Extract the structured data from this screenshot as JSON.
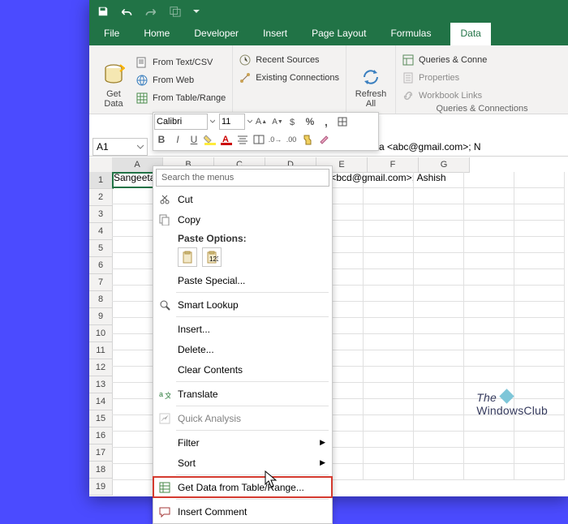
{
  "tabs": {
    "file": "File",
    "home": "Home",
    "developer": "Developer",
    "insert": "Insert",
    "pagelayout": "Page Layout",
    "formulas": "Formulas",
    "data": "Data"
  },
  "ribbon": {
    "getdata": "Get\nData",
    "fromtextcsv": "From Text/CSV",
    "fromweb": "From Web",
    "fromtable": "From Table/Range",
    "recent": "Recent Sources",
    "existing": "Existing Connections",
    "refresh": "Refresh\nAll",
    "queries": "Queries & Conne",
    "properties": "Properties",
    "links": "Workbook Links",
    "group": "Queries & Connections"
  },
  "mini": {
    "font": "Calibri",
    "size": "11"
  },
  "namebox": "A1",
  "formulabar_tail": "a <abc@gmail.com>; N",
  "cell_a1": "Sangeeta",
  "cell_tail": "ola <bcd@gmail.com>; Ashish",
  "cols": [
    "A",
    "B",
    "C",
    "D",
    "E",
    "F",
    "G"
  ],
  "rows": [
    "1",
    "2",
    "3",
    "4",
    "5",
    "6",
    "7",
    "8",
    "9",
    "10",
    "11",
    "12",
    "13",
    "14",
    "15",
    "16",
    "17",
    "18",
    "19"
  ],
  "wmark1": "The",
  "wmark2": "WindowsClub",
  "ctx": {
    "search": "Search the menus",
    "cut": "Cut",
    "copy": "Copy",
    "pasteoptions": "Paste Options:",
    "pastespecial": "Paste Special...",
    "smartlookup": "Smart Lookup",
    "insert": "Insert...",
    "delete": "Delete...",
    "clear": "Clear Contents",
    "translate": "Translate",
    "quick": "Quick Analysis",
    "filter": "Filter",
    "sort": "Sort",
    "getdata": "Get Data from Table/Range...",
    "comment": "Insert Comment"
  }
}
